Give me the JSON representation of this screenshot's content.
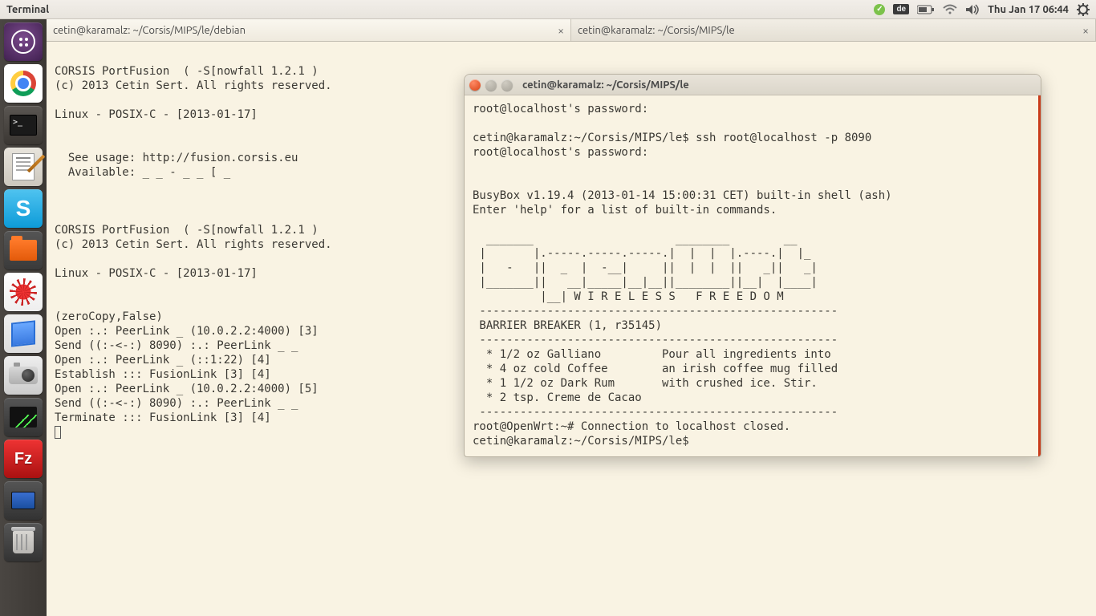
{
  "menubar": {
    "app_title": "Terminal",
    "keyboard_layout": "de",
    "clock": "Thu Jan 17  06:44"
  },
  "launcher": {
    "items": [
      "dash",
      "chrome",
      "terminal",
      "gedit",
      "skype",
      "files",
      "mathematica",
      "virtualbox",
      "camera",
      "system-monitor",
      "filezilla",
      "remote-desktop",
      "trash"
    ]
  },
  "tabs": [
    {
      "title": "cetin@karamalz: ~/Corsis/MIPS/le/debian",
      "active": true
    },
    {
      "title": "cetin@karamalz: ~/Corsis/MIPS/le",
      "active": false
    }
  ],
  "terminal_main": {
    "lines": [
      "",
      "CORSIS PortFusion  ( -S[nowfall 1.2.1 )",
      "(c) 2013 Cetin Sert. All rights reserved.",
      "",
      "Linux - POSIX-C - [2013-01-17]",
      "",
      "",
      "  See usage: http://fusion.corsis.eu",
      "  Available: _ _ - _ _ [ _",
      "",
      "",
      "",
      "CORSIS PortFusion  ( -S[nowfall 1.2.1 )",
      "(c) 2013 Cetin Sert. All rights reserved.",
      "",
      "Linux - POSIX-C - [2013-01-17]",
      "",
      "",
      "(zeroCopy,False)",
      "Open :.: PeerLink _ (10.0.2.2:4000) [3]",
      "Send ((:-<-:) 8090) :.: PeerLink _ _",
      "Open :.: PeerLink _ (::1:22) [4]",
      "Establish ::: FusionLink [3] [4]",
      "Open :.: PeerLink _ (10.0.2.2:4000) [5]",
      "Send ((:-<-:) 8090) :.: PeerLink _ _",
      "Terminate ::: FusionLink [3] [4]"
    ]
  },
  "window_b": {
    "title": "cetin@karamalz: ~/Corsis/MIPS/le",
    "lines": [
      "root@localhost's password:",
      "",
      "cetin@karamalz:~/Corsis/MIPS/le$ ssh root@localhost -p 8090",
      "root@localhost's password:",
      "",
      "",
      "BusyBox v1.19.4 (2013-01-14 15:00:31 CET) built-in shell (ash)",
      "Enter 'help' for a list of built-in commands.",
      "",
      "  _______                     ________        __",
      " |       |.-----.-----.-----.|  |  |  |.----.|  |_",
      " |   -   ||  _  |  -__|     ||  |  |  ||   _||   _|",
      " |_______||   __|_____|__|__||________||__|  |____|",
      "          |__| W I R E L E S S   F R E E D O M",
      " -----------------------------------------------------",
      " BARRIER BREAKER (1, r35145)",
      " -----------------------------------------------------",
      "  * 1/2 oz Galliano         Pour all ingredients into",
      "  * 4 oz cold Coffee        an irish coffee mug filled",
      "  * 1 1/2 oz Dark Rum       with crushed ice. Stir.",
      "  * 2 tsp. Creme de Cacao",
      " -----------------------------------------------------",
      "root@OpenWrt:~# Connection to localhost closed.",
      "cetin@karamalz:~/Corsis/MIPS/le$"
    ]
  }
}
